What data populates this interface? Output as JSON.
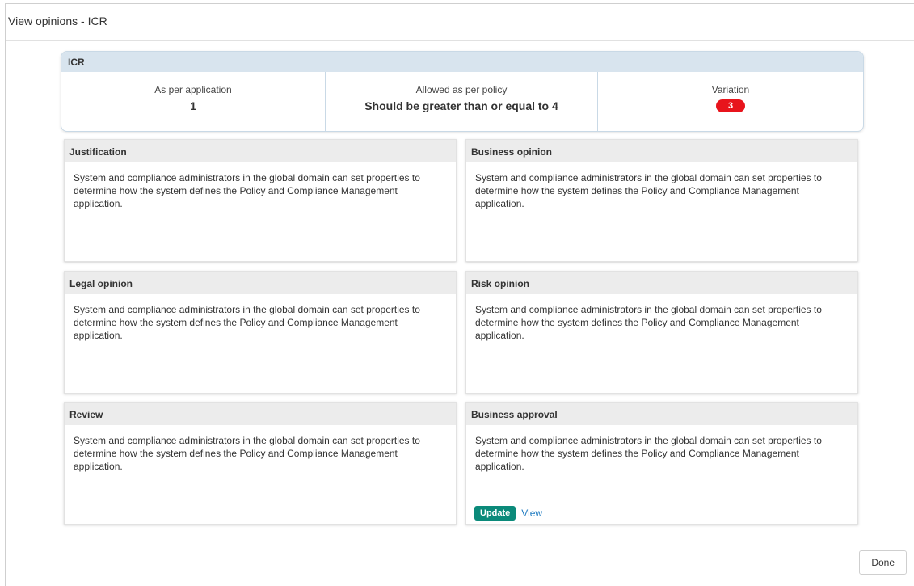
{
  "dialog": {
    "title": "View opinions - ICR"
  },
  "icr": {
    "header": "ICR",
    "as_per_application_label": "As per application",
    "as_per_application_value": "1",
    "allowed_label": "Allowed as per policy",
    "allowed_value": "Should be greater than or equal to 4",
    "variation_label": "Variation",
    "variation_value": "3"
  },
  "panels": [
    {
      "title": "Justification",
      "body": "System and compliance administrators in the global domain can set properties to determine how the system defines the Policy and Compliance Management application."
    },
    {
      "title": "Business opinion",
      "body": "System and compliance administrators in the global domain can set properties to determine how the system defines the Policy and Compliance Management application."
    },
    {
      "title": "Legal opinion",
      "body": "System and compliance administrators in the global domain can set properties to determine how the system defines the Policy and Compliance Management application."
    },
    {
      "title": "Risk opinion",
      "body": "System and compliance administrators in the global domain can set properties to determine how the system defines the Policy and Compliance Management application."
    },
    {
      "title": "Review",
      "body": "System and compliance administrators in the global domain can set properties to determine how the system defines the Policy and Compliance Management application."
    },
    {
      "title": "Business approval",
      "body": "System and compliance administrators in the global domain can set properties to determine how the system defines the Policy and Compliance Management application."
    }
  ],
  "actions": {
    "update_label": "Update",
    "view_label": "View",
    "done_label": "Done"
  },
  "colors": {
    "badge_red": "#e8141c",
    "update_teal": "#0b8a7a",
    "link_blue": "#1f7bc1"
  }
}
